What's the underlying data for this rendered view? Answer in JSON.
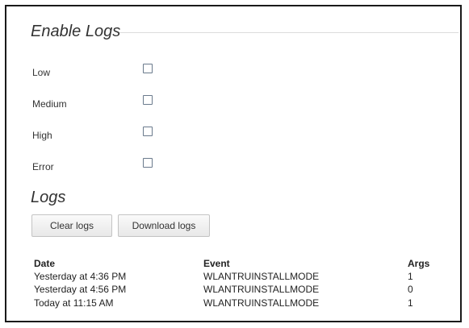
{
  "enable_logs": {
    "title": "Enable Logs",
    "levels": [
      {
        "label": "Low",
        "checked": false
      },
      {
        "label": "Medium",
        "checked": false
      },
      {
        "label": "High",
        "checked": false
      },
      {
        "label": "Error",
        "checked": false
      }
    ]
  },
  "logs": {
    "title": "Logs",
    "clear_label": "Clear logs",
    "download_label": "Download logs",
    "columns": [
      "Date",
      "Event",
      "Args"
    ],
    "rows": [
      [
        "Yesterday at 4:36 PM",
        "WLANTRUINSTALLMODE",
        "1"
      ],
      [
        "Yesterday at 4:56 PM",
        "WLANTRUINSTALLMODE",
        "0"
      ],
      [
        "Today at 11:15 AM",
        "WLANTRUINSTALLMODE",
        "1"
      ]
    ]
  }
}
